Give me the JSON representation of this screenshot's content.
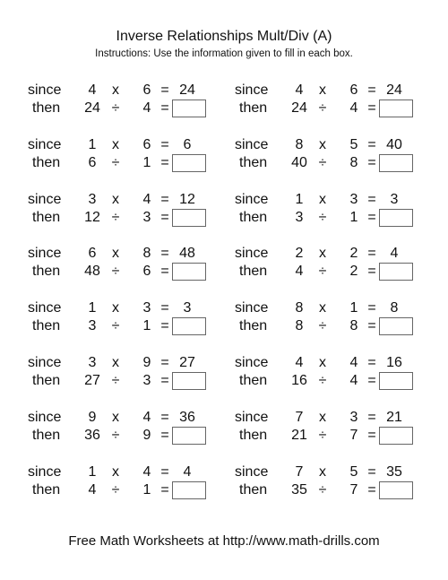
{
  "worksheet": {
    "title": "Inverse Relationships Mult/Div (A)",
    "instructions": "Instructions: Use the information given to fill in each box.",
    "labels": {
      "since": "since",
      "then": "then",
      "times": "x",
      "divide": "÷",
      "equals": "="
    },
    "problems": [
      {
        "a": "4",
        "b": "6",
        "product": "24",
        "dividend": "24",
        "divisor": "4",
        "answer": ""
      },
      {
        "a": "4",
        "b": "6",
        "product": "24",
        "dividend": "24",
        "divisor": "4",
        "answer": ""
      },
      {
        "a": "1",
        "b": "6",
        "product": "6",
        "dividend": "6",
        "divisor": "1",
        "answer": ""
      },
      {
        "a": "8",
        "b": "5",
        "product": "40",
        "dividend": "40",
        "divisor": "8",
        "answer": ""
      },
      {
        "a": "3",
        "b": "4",
        "product": "12",
        "dividend": "12",
        "divisor": "3",
        "answer": ""
      },
      {
        "a": "1",
        "b": "3",
        "product": "3",
        "dividend": "3",
        "divisor": "1",
        "answer": ""
      },
      {
        "a": "6",
        "b": "8",
        "product": "48",
        "dividend": "48",
        "divisor": "6",
        "answer": ""
      },
      {
        "a": "2",
        "b": "2",
        "product": "4",
        "dividend": "4",
        "divisor": "2",
        "answer": ""
      },
      {
        "a": "1",
        "b": "3",
        "product": "3",
        "dividend": "3",
        "divisor": "1",
        "answer": ""
      },
      {
        "a": "8",
        "b": "1",
        "product": "8",
        "dividend": "8",
        "divisor": "8",
        "answer": ""
      },
      {
        "a": "3",
        "b": "9",
        "product": "27",
        "dividend": "27",
        "divisor": "3",
        "answer": ""
      },
      {
        "a": "4",
        "b": "4",
        "product": "16",
        "dividend": "16",
        "divisor": "4",
        "answer": ""
      },
      {
        "a": "9",
        "b": "4",
        "product": "36",
        "dividend": "36",
        "divisor": "9",
        "answer": ""
      },
      {
        "a": "7",
        "b": "3",
        "product": "21",
        "dividend": "21",
        "divisor": "7",
        "answer": ""
      },
      {
        "a": "1",
        "b": "4",
        "product": "4",
        "dividend": "4",
        "divisor": "1",
        "answer": ""
      },
      {
        "a": "7",
        "b": "5",
        "product": "35",
        "dividend": "35",
        "divisor": "7",
        "answer": ""
      }
    ],
    "footer": "Free Math Worksheets at http://www.math-drills.com"
  }
}
